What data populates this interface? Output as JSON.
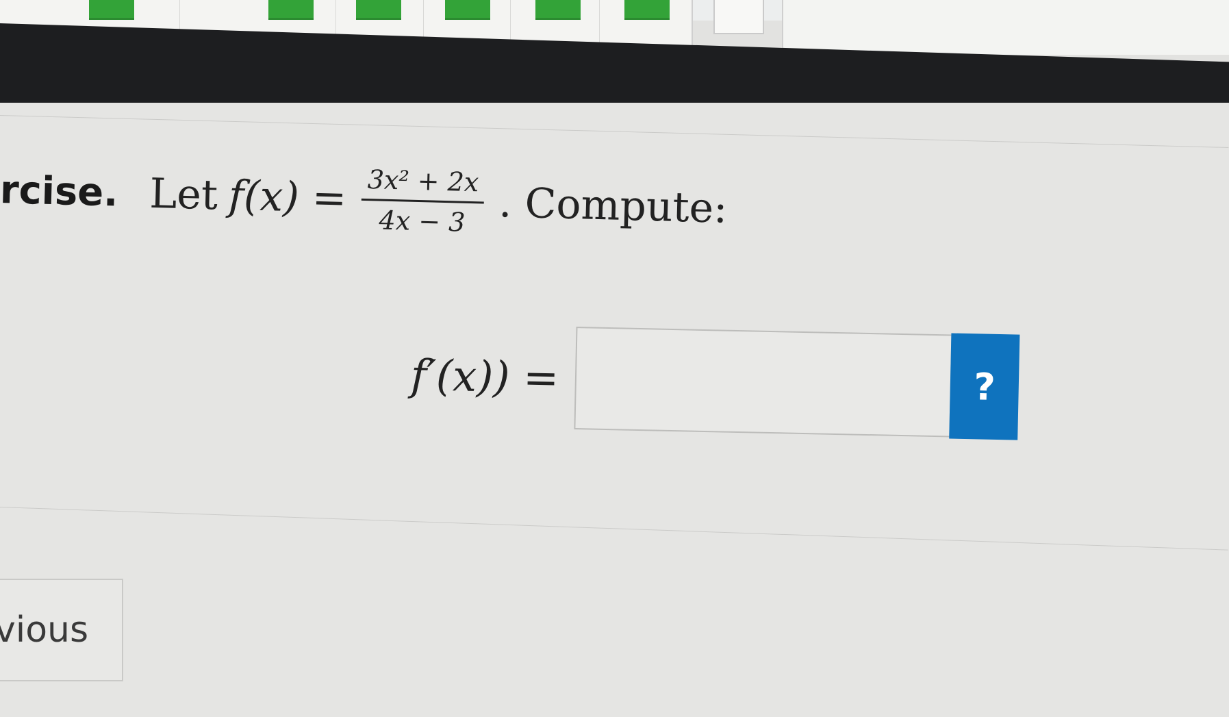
{
  "problem": {
    "exercise_label": "rcise.",
    "let_text": "Let",
    "function_name": "f(x) =",
    "numerator": "3x² + 2x",
    "denominator": "4x − 3",
    "compute_text": ". Compute:"
  },
  "answer": {
    "label": "f′(x)) =",
    "input_value": "",
    "help_label": "?"
  },
  "nav": {
    "previous_label": "vious"
  },
  "colors": {
    "progress_complete": "#33a338",
    "help_button": "#0f73be",
    "header_band": "#1d1e20"
  }
}
